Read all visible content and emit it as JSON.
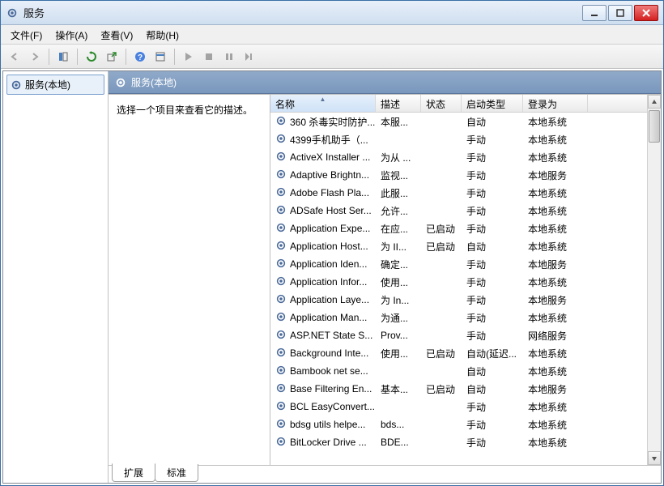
{
  "window": {
    "title": "服务"
  },
  "menubar": [
    "文件(F)",
    "操作(A)",
    "查看(V)",
    "帮助(H)"
  ],
  "sidebar": {
    "root_label": "服务(本地)"
  },
  "main": {
    "header": "服务(本地)",
    "desc_prompt": "选择一个项目来查看它的描述。",
    "columns": {
      "name": "名称",
      "desc": "描述",
      "status": "状态",
      "start": "启动类型",
      "logon": "登录为"
    },
    "rows": [
      {
        "name": "360 杀毒实时防护...",
        "desc": "本服...",
        "status": "",
        "start": "自动",
        "logon": "本地系统"
      },
      {
        "name": "4399手机助手（...",
        "desc": "",
        "status": "",
        "start": "手动",
        "logon": "本地系统"
      },
      {
        "name": "ActiveX Installer ...",
        "desc": "为从 ...",
        "status": "",
        "start": "手动",
        "logon": "本地系统"
      },
      {
        "name": "Adaptive Brightn...",
        "desc": "监视...",
        "status": "",
        "start": "手动",
        "logon": "本地服务"
      },
      {
        "name": "Adobe Flash Pla...",
        "desc": "此服...",
        "status": "",
        "start": "手动",
        "logon": "本地系统"
      },
      {
        "name": "ADSafe Host Ser...",
        "desc": "允许...",
        "status": "",
        "start": "手动",
        "logon": "本地系统"
      },
      {
        "name": "Application Expe...",
        "desc": "在应...",
        "status": "已启动",
        "start": "手动",
        "logon": "本地系统"
      },
      {
        "name": "Application Host...",
        "desc": "为 II...",
        "status": "已启动",
        "start": "自动",
        "logon": "本地系统"
      },
      {
        "name": "Application Iden...",
        "desc": "确定...",
        "status": "",
        "start": "手动",
        "logon": "本地服务"
      },
      {
        "name": "Application Infor...",
        "desc": "使用...",
        "status": "",
        "start": "手动",
        "logon": "本地系统"
      },
      {
        "name": "Application Laye...",
        "desc": "为 In...",
        "status": "",
        "start": "手动",
        "logon": "本地服务"
      },
      {
        "name": "Application Man...",
        "desc": "为通...",
        "status": "",
        "start": "手动",
        "logon": "本地系统"
      },
      {
        "name": "ASP.NET State S...",
        "desc": "Prov...",
        "status": "",
        "start": "手动",
        "logon": "网络服务"
      },
      {
        "name": "Background Inte...",
        "desc": "使用...",
        "status": "已启动",
        "start": "自动(延迟...",
        "logon": "本地系统"
      },
      {
        "name": "Bambook net se...",
        "desc": "",
        "status": "",
        "start": "自动",
        "logon": "本地系统"
      },
      {
        "name": "Base Filtering En...",
        "desc": "基本...",
        "status": "已启动",
        "start": "自动",
        "logon": "本地服务"
      },
      {
        "name": "BCL EasyConvert...",
        "desc": "",
        "status": "",
        "start": "手动",
        "logon": "本地系统"
      },
      {
        "name": "bdsg utils helpe...",
        "desc": "bds...",
        "status": "",
        "start": "手动",
        "logon": "本地系统"
      },
      {
        "name": "BitLocker Drive ...",
        "desc": "BDE...",
        "status": "",
        "start": "手动",
        "logon": "本地系统"
      }
    ]
  },
  "footer_tabs": {
    "ext": "扩展",
    "std": "标准"
  }
}
